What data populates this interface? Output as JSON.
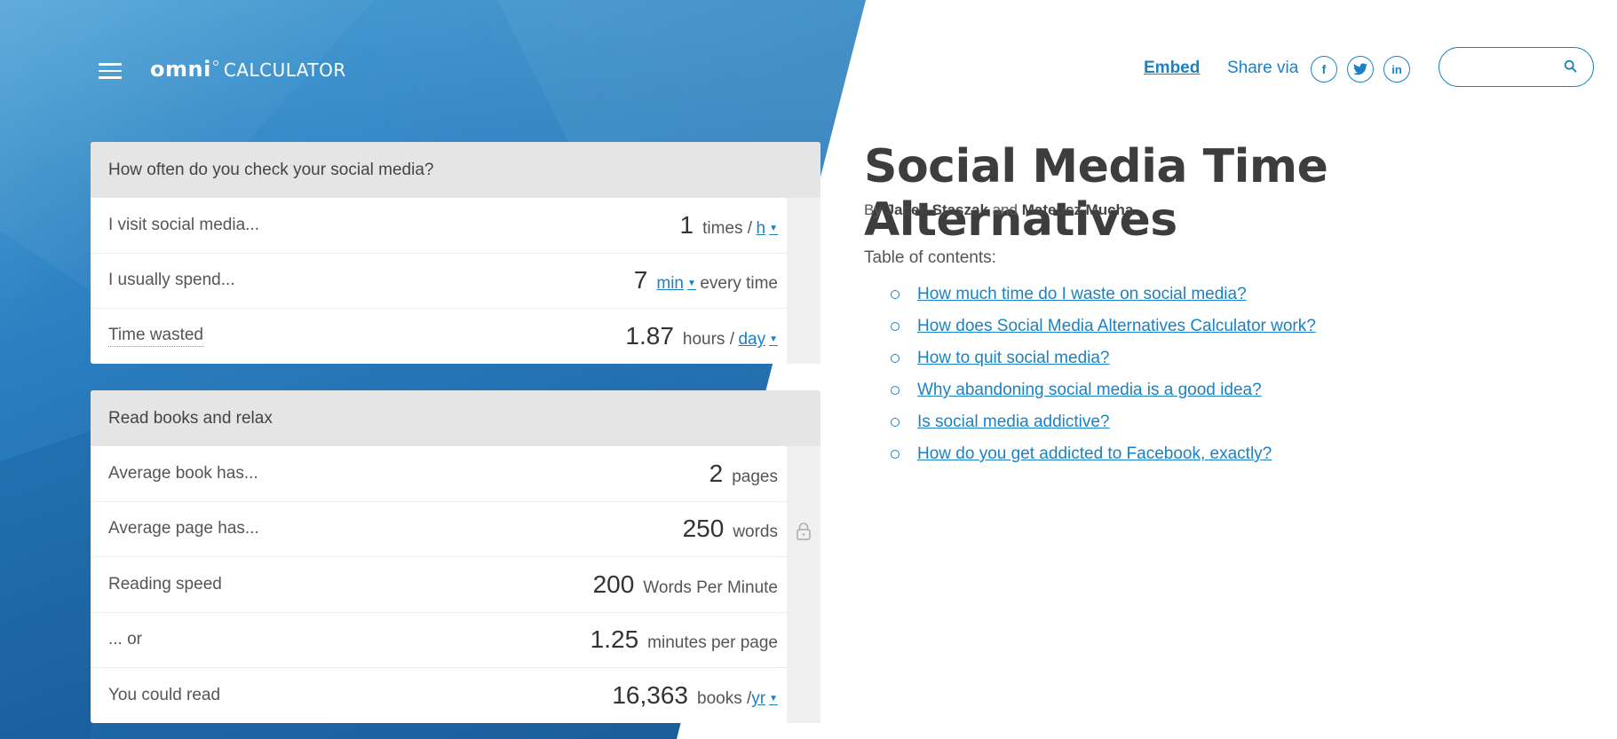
{
  "header": {
    "logo_omni": "omni",
    "logo_calc": "CALCULATOR",
    "embed": "Embed",
    "share_label": "Share via",
    "social": [
      "f",
      "t",
      "in"
    ],
    "search_placeholder": ""
  },
  "card1": {
    "title": "How often do you check your social media?",
    "rows": [
      {
        "label": "I visit social media...",
        "value": "1",
        "unit_pre": "times /",
        "unit_link": "h"
      },
      {
        "label": "I usually spend...",
        "value": "7",
        "unit_link": "min",
        "unit_post": "every time"
      },
      {
        "label": "Time wasted",
        "value": "1.87",
        "unit_pre": "hours /",
        "unit_link": "day"
      }
    ]
  },
  "card2": {
    "title": "Read books and relax",
    "rows": [
      {
        "label": "Average book has...",
        "value": "2",
        "unit": "pages"
      },
      {
        "label": "Average page has...",
        "value": "250",
        "unit": "words"
      },
      {
        "label": "Reading speed",
        "value": "200",
        "unit": "Words Per Minute"
      },
      {
        "label": "... or",
        "value": "1.25",
        "unit": "minutes per page"
      },
      {
        "label": "You could read",
        "value": "16,363",
        "unit_pre": "books /",
        "unit_link": "yr"
      }
    ]
  },
  "article": {
    "title": "Social Media Time Alternatives",
    "by": "By",
    "author1": "Jacek Staszak",
    "and": "and",
    "author2": "Mateusz Mucha",
    "period": ".",
    "toc_label": "Table of contents:",
    "toc": [
      "How much time do I waste on social media?",
      "How does Social Media Alternatives Calculator work?",
      "How to quit social media?",
      "Why abandoning social media is a good idea?",
      "Is social media addictive?",
      "How do you get addicted to Facebook, exactly?"
    ]
  },
  "colors": {
    "accent": "#1a82c4",
    "bg_blue": "#2a7fc0",
    "card_head": "#e5e5e5"
  }
}
